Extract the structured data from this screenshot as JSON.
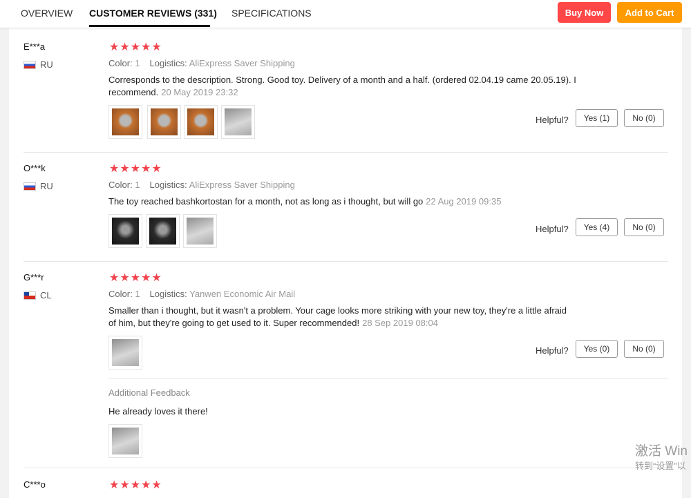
{
  "tabs": [
    {
      "label": "OVERVIEW"
    },
    {
      "label": "CUSTOMER REVIEWS (331)"
    },
    {
      "label": "SPECIFICATIONS"
    }
  ],
  "actions": {
    "buy_now": "Buy Now",
    "add_to_cart": "Add to Cart"
  },
  "colors": {
    "accent_red": "#ff4747",
    "accent_orange": "#ff9a00",
    "stars": "#f0434d"
  },
  "labels": {
    "color": "Color:",
    "logistics": "Logistics:",
    "helpful": "Helpful?",
    "additional_feedback": "Additional Feedback"
  },
  "reviews": [
    {
      "user": "E***a",
      "country": "RU",
      "stars": "★★★★★",
      "color": "1",
      "logistics": "AliExpress Saver Shipping",
      "text_line1": "Corresponds to the description. Strong. Good toy. Delivery of a month and a half. (ordered 02.04.19 came 20.05.19). I",
      "text_line2": "recommend.",
      "date": "20 May 2019 23:32",
      "yes": "Yes (1)",
      "no": "No (0)"
    },
    {
      "user": "O***k",
      "country": "RU",
      "stars": "★★★★★",
      "color": "1",
      "logistics": "AliExpress Saver Shipping",
      "text_line1": "The toy reached bashkortostan for a month, not as long as i thought, but will go",
      "date": "22 Aug 2019 09:35",
      "yes": "Yes (4)",
      "no": "No (0)"
    },
    {
      "user": "G***r",
      "country": "CL",
      "stars": "★★★★★",
      "color": "1",
      "logistics": "Yanwen Economic Air Mail",
      "text_line1": "Smaller than i thought, but it wasn't a problem. Your cage looks more striking with your new toy, they're a little afraid",
      "text_line2": "of him, but they're going to get used to it. Super recommended!",
      "date": "28 Sep 2019 08:04",
      "yes": "Yes (0)",
      "no": "No (0)",
      "additional_text": "He already loves it there!"
    },
    {
      "user": "C***o",
      "stars": "★★★★★"
    }
  ],
  "watermark": {
    "line1": "激活 Win",
    "line2": "转到“设置”以"
  }
}
